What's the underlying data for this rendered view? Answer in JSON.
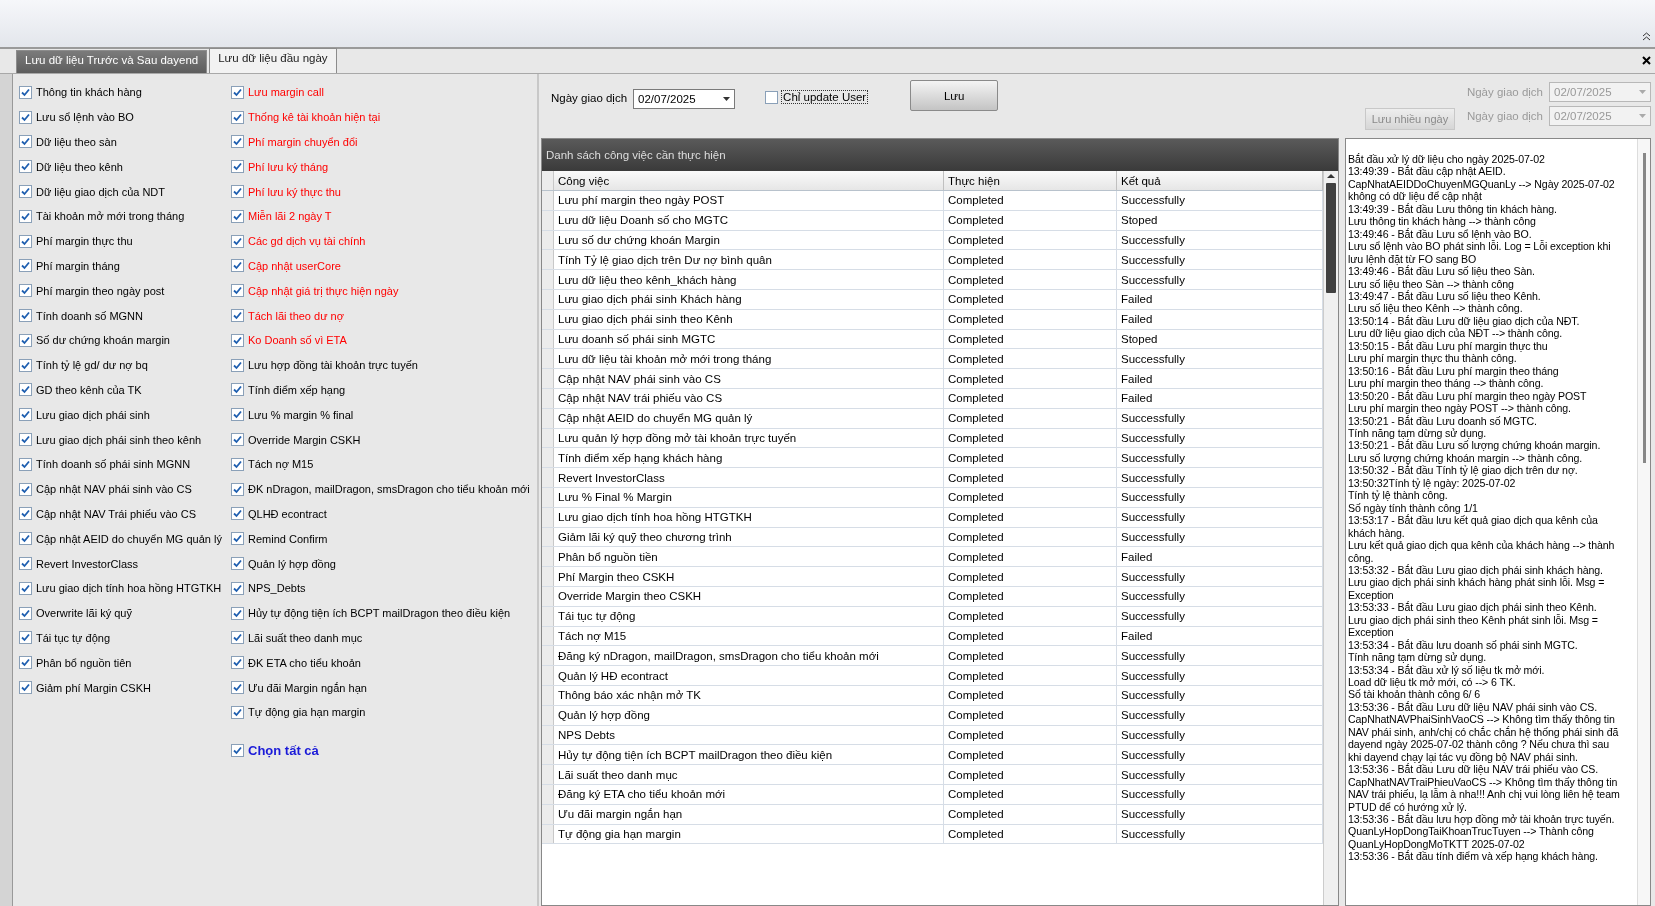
{
  "tabs": [
    {
      "label": "Lưu dữ liệu Trước và Sau dayend",
      "selected": false
    },
    {
      "label": "Lưu dữ liệu đầu ngày",
      "selected": true
    }
  ],
  "options": {
    "columns": [
      [
        {
          "label": "Thông tin khách hàng",
          "checked": true
        },
        {
          "label": "Lưu sổ lệnh vào BO",
          "checked": true
        },
        {
          "label": "Dữ liệu theo sàn",
          "checked": true
        },
        {
          "label": "Dữ liệu theo kênh",
          "checked": true
        },
        {
          "label": "Dữ liệu giao dịch của NDT",
          "checked": true
        },
        {
          "label": "Tài khoản mở mới trong tháng",
          "checked": true
        },
        {
          "label": "Phí margin thực thu",
          "checked": true
        },
        {
          "label": "Phí margin tháng",
          "checked": true
        },
        {
          "label": "Phí margin theo ngày post",
          "checked": true
        },
        {
          "label": "Tính doanh số MGNN",
          "checked": true
        },
        {
          "label": "Số dư chứng khoán margin",
          "checked": true
        },
        {
          "label": "Tính tỷ lệ gd/ dư nợ bq",
          "checked": true
        },
        {
          "label": "GD theo kênh của TK",
          "checked": true
        },
        {
          "label": "Lưu giao dịch phái sinh",
          "checked": true
        },
        {
          "label": "Lưu giao dịch phái sinh theo kênh",
          "checked": true
        },
        {
          "label": "Tính doanh số phái sinh MGNN",
          "checked": true
        },
        {
          "label": "Cập nhật NAV phái sinh vào CS",
          "checked": true
        },
        {
          "label": "Cập nhật NAV Trái phiếu vào CS",
          "checked": true
        },
        {
          "label": "Cập nhật AEID do chuyển MG quản lý",
          "checked": true
        },
        {
          "label": "Revert InvestorClass",
          "checked": true
        },
        {
          "label": "Lưu giao dịch tính hoa hồng HTGTKH",
          "checked": true
        },
        {
          "label": "Overwrite lãi ký quỹ",
          "checked": true
        },
        {
          "label": "Tái tục tự động",
          "checked": true
        },
        {
          "label": "Phân bổ nguồn tiên",
          "checked": true
        },
        {
          "label": "Giảm phí Margin CSKH",
          "checked": true
        }
      ],
      [
        {
          "label": "Lưu margin call",
          "checked": true,
          "color": "#ff0000"
        },
        {
          "label": "Thống kê tài khoản hiện tại",
          "checked": true,
          "color": "#ff0000"
        },
        {
          "label": "Phí margin chuyển đổi",
          "checked": true,
          "color": "#ff0000"
        },
        {
          "label": "Phí lưu ký tháng",
          "checked": true,
          "color": "#ff0000"
        },
        {
          "label": "Phí lưu ký thực thu",
          "checked": true,
          "color": "#ff0000"
        },
        {
          "label": "Miễn lãi 2 ngày T",
          "checked": true,
          "color": "#ff0000"
        },
        {
          "label": "Các gd dịch vụ tài chính",
          "checked": true,
          "color": "#ff0000"
        },
        {
          "label": "Cập nhật userCore",
          "checked": true,
          "color": "#ff0000"
        },
        {
          "label": "Cập nhật giá trị thực hiện ngày",
          "checked": true,
          "color": "#ff0000"
        },
        {
          "label": "Tách lãi theo dư nợ",
          "checked": true,
          "color": "#ff0000"
        },
        {
          "label": "Ko Doanh số vì ETA",
          "checked": true,
          "color": "#ff0000"
        },
        {
          "label": "Lưu hợp đồng tài khoản trực tuyến",
          "checked": true,
          "color": "#000000"
        },
        {
          "label": "Tính điểm xếp hạng",
          "checked": true,
          "color": "#000000"
        },
        {
          "label": "Lưu % margin % final",
          "checked": true,
          "color": "#000000"
        },
        {
          "label": "Override Margin CSKH",
          "checked": true,
          "color": "#000000"
        },
        {
          "label": "Tách nợ M15",
          "checked": true,
          "color": "#000000"
        },
        {
          "label": "ĐK nDragon, mailDragon, smsDragon cho tiểu khoản mới",
          "checked": true,
          "color": "#000000"
        },
        {
          "label": "QLHĐ econtract",
          "checked": true,
          "color": "#000000"
        },
        {
          "label": "Remind Confirm",
          "checked": true,
          "color": "#000000"
        },
        {
          "label": "Quản lý hợp đồng",
          "checked": true,
          "color": "#000000"
        },
        {
          "label": "NPS_Debts",
          "checked": true,
          "color": "#000000"
        },
        {
          "label": "Hủy tự động tiện ích BCPT mailDragon theo điều kiện",
          "checked": true,
          "color": "#000000"
        },
        {
          "label": "Lãi suất theo danh mục",
          "checked": true,
          "color": "#000000"
        },
        {
          "label": "ĐK ETA cho tiểu khoản",
          "checked": true,
          "color": "#000000"
        },
        {
          "label": "Ưu đãi Margin ngắn hạn",
          "checked": true,
          "color": "#000000"
        },
        {
          "label": "Tự động gia hạn margin",
          "checked": true,
          "color": "#000000"
        }
      ]
    ],
    "select_all": {
      "label": "Chọn tất cả",
      "checked": true
    }
  },
  "toolbar": {
    "date_label": "Ngày giao dịch",
    "date_value": "02/07/2025",
    "only_user": {
      "label": "Chỉ update User",
      "checked": false
    },
    "save_button": "Lưu"
  },
  "tasks": {
    "title": "Danh sách công việc cần thực hiện",
    "columns": [
      "Công việc",
      "Thực hiện",
      "Kết quả"
    ],
    "rows": [
      [
        "Lưu phí margin theo ngày POST",
        "Completed",
        "Successfully"
      ],
      [
        "Lưu dữ liệu Doanh số cho MGTC",
        "Completed",
        "Stoped"
      ],
      [
        "Lưu số dư chứng khoán Margin",
        "Completed",
        "Successfully"
      ],
      [
        "Tính Tỷ lệ giao dịch trên Dư nợ bình quân",
        "Completed",
        "Successfully"
      ],
      [
        "Lưu dữ liệu theo kênh_khách hàng",
        "Completed",
        "Successfully"
      ],
      [
        "Lưu giao dịch phái sinh Khách hàng",
        "Completed",
        "Failed"
      ],
      [
        "Lưu giao dịch phái sinh theo Kênh",
        "Completed",
        "Failed"
      ],
      [
        "Lưu doanh số phái sinh MGTC",
        "Completed",
        "Stoped"
      ],
      [
        "Lưu dữ liệu tài khoản mở mới trong tháng",
        "Completed",
        "Successfully"
      ],
      [
        "Cập nhật NAV phái sinh vào CS",
        "Completed",
        "Failed"
      ],
      [
        "Cập nhật NAV trái phiếu vào CS",
        "Completed",
        "Failed"
      ],
      [
        "Cập nhật AEID do chuyển MG quản lý",
        "Completed",
        "Successfully"
      ],
      [
        "Lưu quản lý hợp đồng mở tài khoản trực tuyến",
        "Completed",
        "Successfully"
      ],
      [
        "Tính điểm xếp hạng khách hàng",
        "Completed",
        "Successfully"
      ],
      [
        "Revert InvestorClass",
        "Completed",
        "Successfully"
      ],
      [
        "Lưu % Final % Margin",
        "Completed",
        "Successfully"
      ],
      [
        "Lưu giao dịch tính hoa hồng HTGTKH",
        "Completed",
        "Successfully"
      ],
      [
        "Giảm lãi ký quỹ theo chương trình",
        "Completed",
        "Successfully"
      ],
      [
        "Phân bổ nguồn tiền",
        "Completed",
        "Failed"
      ],
      [
        "Phí Margin theo CSKH",
        "Completed",
        "Successfully"
      ],
      [
        "Override Margin theo CSKH",
        "Completed",
        "Successfully"
      ],
      [
        "Tái tục tự động",
        "Completed",
        "Successfully"
      ],
      [
        "Tách nợ M15",
        "Completed",
        "Failed"
      ],
      [
        "Đăng ký nDragon, mailDragon, smsDragon cho tiểu khoản mới",
        "Completed",
        "Successfully"
      ],
      [
        "Quản lý HĐ econtract",
        "Completed",
        "Successfully"
      ],
      [
        "Thông báo xác nhận mở TK",
        "Completed",
        "Successfully"
      ],
      [
        "Quản lý hợp đồng",
        "Completed",
        "Successfully"
      ],
      [
        "NPS Debts",
        "Completed",
        "Successfully"
      ],
      [
        "Hủy tự động tiện ích BCPT mailDragon theo điều kiện",
        "Completed",
        "Successfully"
      ],
      [
        "Lãi suất theo danh mục",
        "Completed",
        "Successfully"
      ],
      [
        "Đăng ký ETA cho tiểu khoản mới",
        "Completed",
        "Successfully"
      ],
      [
        "Ưu đãi margin ngắn hạn",
        "Completed",
        "Successfully"
      ],
      [
        "Tự động gia hạn margin",
        "Completed",
        "Successfully"
      ]
    ]
  },
  "range": {
    "fields": [
      {
        "label": "Ngày giao dịch",
        "value": "02/07/2025",
        "disabled": true
      },
      {
        "label": "Ngày giao dịch",
        "value": "02/07/2025",
        "disabled": true
      }
    ],
    "button": {
      "label": "Lưu nhiều ngày",
      "disabled": true
    }
  },
  "log": [
    "Bắt đầu xử lý dữ liệu cho ngày 2025-07-02",
    "13:49:39 - Bắt đầu cập nhật AEID.",
    "CapNhatAEIDDoChuyenMGQuanLy --> Ngày 2025-07-02",
    "không có dữ liệu để cập nhật",
    "13:49:39 - Bắt đầu Lưu thông tin khách hàng.",
    "Lưu thông tin khách hàng --> thành công",
    "13:49:46 - Bắt đầu Lưu sổ lệnh vào BO.",
    "Lưu sổ lệnh vào BO phát sinh lỗi. Log = Lỗi exception khi",
    "lưu lệnh đặt từ FO sang BO",
    "13:49:46 - Bắt đầu Lưu số liệu theo Sàn.",
    "Lưu số liệu theo Sàn --> thành công",
    "13:49:47 - Bắt đầu Lưu số liệu theo Kênh.",
    "Lưu số liệu theo Kênh --> thành công.",
    "13:50:14 - Bắt đầu Lưu dữ liệu giao dịch của NĐT.",
    "Lưu dữ liệu giao dịch của NĐT --> thành công.",
    "13:50:15 - Bắt đầu Lưu phí margin thực thu",
    "Lưu phí margin thực thu thành công.",
    "13:50:16 - Bắt đầu Lưu phí margin theo tháng",
    "Lưu phí margin theo tháng --> thành công.",
    "13:50:20 - Bắt đầu Lưu phí margin theo ngày POST",
    "Lưu phí margin theo ngày POST --> thành công.",
    "13:50:21 - Bắt đầu Lưu doanh số MGTC.",
    "Tính năng tạm dừng sử dụng.",
    "13:50:21 - Bắt đầu Lưu số lượng chứng khoán margin.",
    "Lưu số lượng chứng khoán margin --> thành công.",
    "13:50:32 - Bắt đầu Tính tỷ lệ giao dịch trên dư nợ.",
    "13:50:32Tính tỷ lệ ngày: 2025-07-02",
    "Tính tỷ lệ thành công.",
    "Số ngày tính thành công 1/1",
    "13:53:17 - Bắt đầu lưu kết quả giao dịch qua kênh của",
    "khách hàng.",
    "Lưu kết quả giao dịch qua kênh của khách hàng --> thành",
    "công.",
    "13:53:32 - Bắt đầu Lưu giao dịch phái sinh khách hàng.",
    "Lưu giao dịch phái sinh khách hàng phát sinh lỗi. Msg =",
    "Exception",
    "13:53:33 - Bắt đầu Lưu giao dịch phái sinh theo Kênh.",
    "Lưu giao dịch phái sinh theo Kênh phát sinh lỗi. Msg =",
    "Exception",
    "13:53:34 - Bắt đầu lưu doanh số phái sinh MGTC.",
    "Tính năng tạm dừng sử dụng.",
    "13:53:34 - Bắt đầu xử lý số liệu tk mở mới.",
    "Load dữ liệu tk mở mới, có --> 6 TK.",
    "Số tài khoản thành công 6/ 6",
    "13:53:36 - Bắt đầu Lưu dữ liệu NAV phái sinh vào CS.",
    "CapNhatNAVPhaiSinhVaoCS --> Không tìm thấy thông tin",
    "NAV phái sinh, anh/chị có chắc chắn hệ thống phái sinh đã",
    "dayend ngày 2025-07-02 thành công ? Nếu chưa thì sau",
    "khi dayend chạy lại tác vụ đồng bộ NAV phái sinh.",
    "13:53:36 - Bắt đầu Lưu dữ liệu NAV trái phiếu vào CS.",
    "CapNhatNAVTraiPhieuVaoCS --> Không tìm thấy thông tin",
    "NAV trái phiếu, lạ lẫm à nha!!! Anh chị vui lòng liên hệ team",
    "PTUD để có hướng xử lý.",
    "13:53:36 - Bắt đầu lưu hợp đồng mở tài khoản trực tuyến.",
    "QuanLyHopDongTaiKhoanTrucTuyen --> Thành công",
    "QuanLyHopDongMoTKTT 2025-07-02",
    "13:53:36 - Bắt đầu tính điểm và xếp hạng khách hàng."
  ]
}
